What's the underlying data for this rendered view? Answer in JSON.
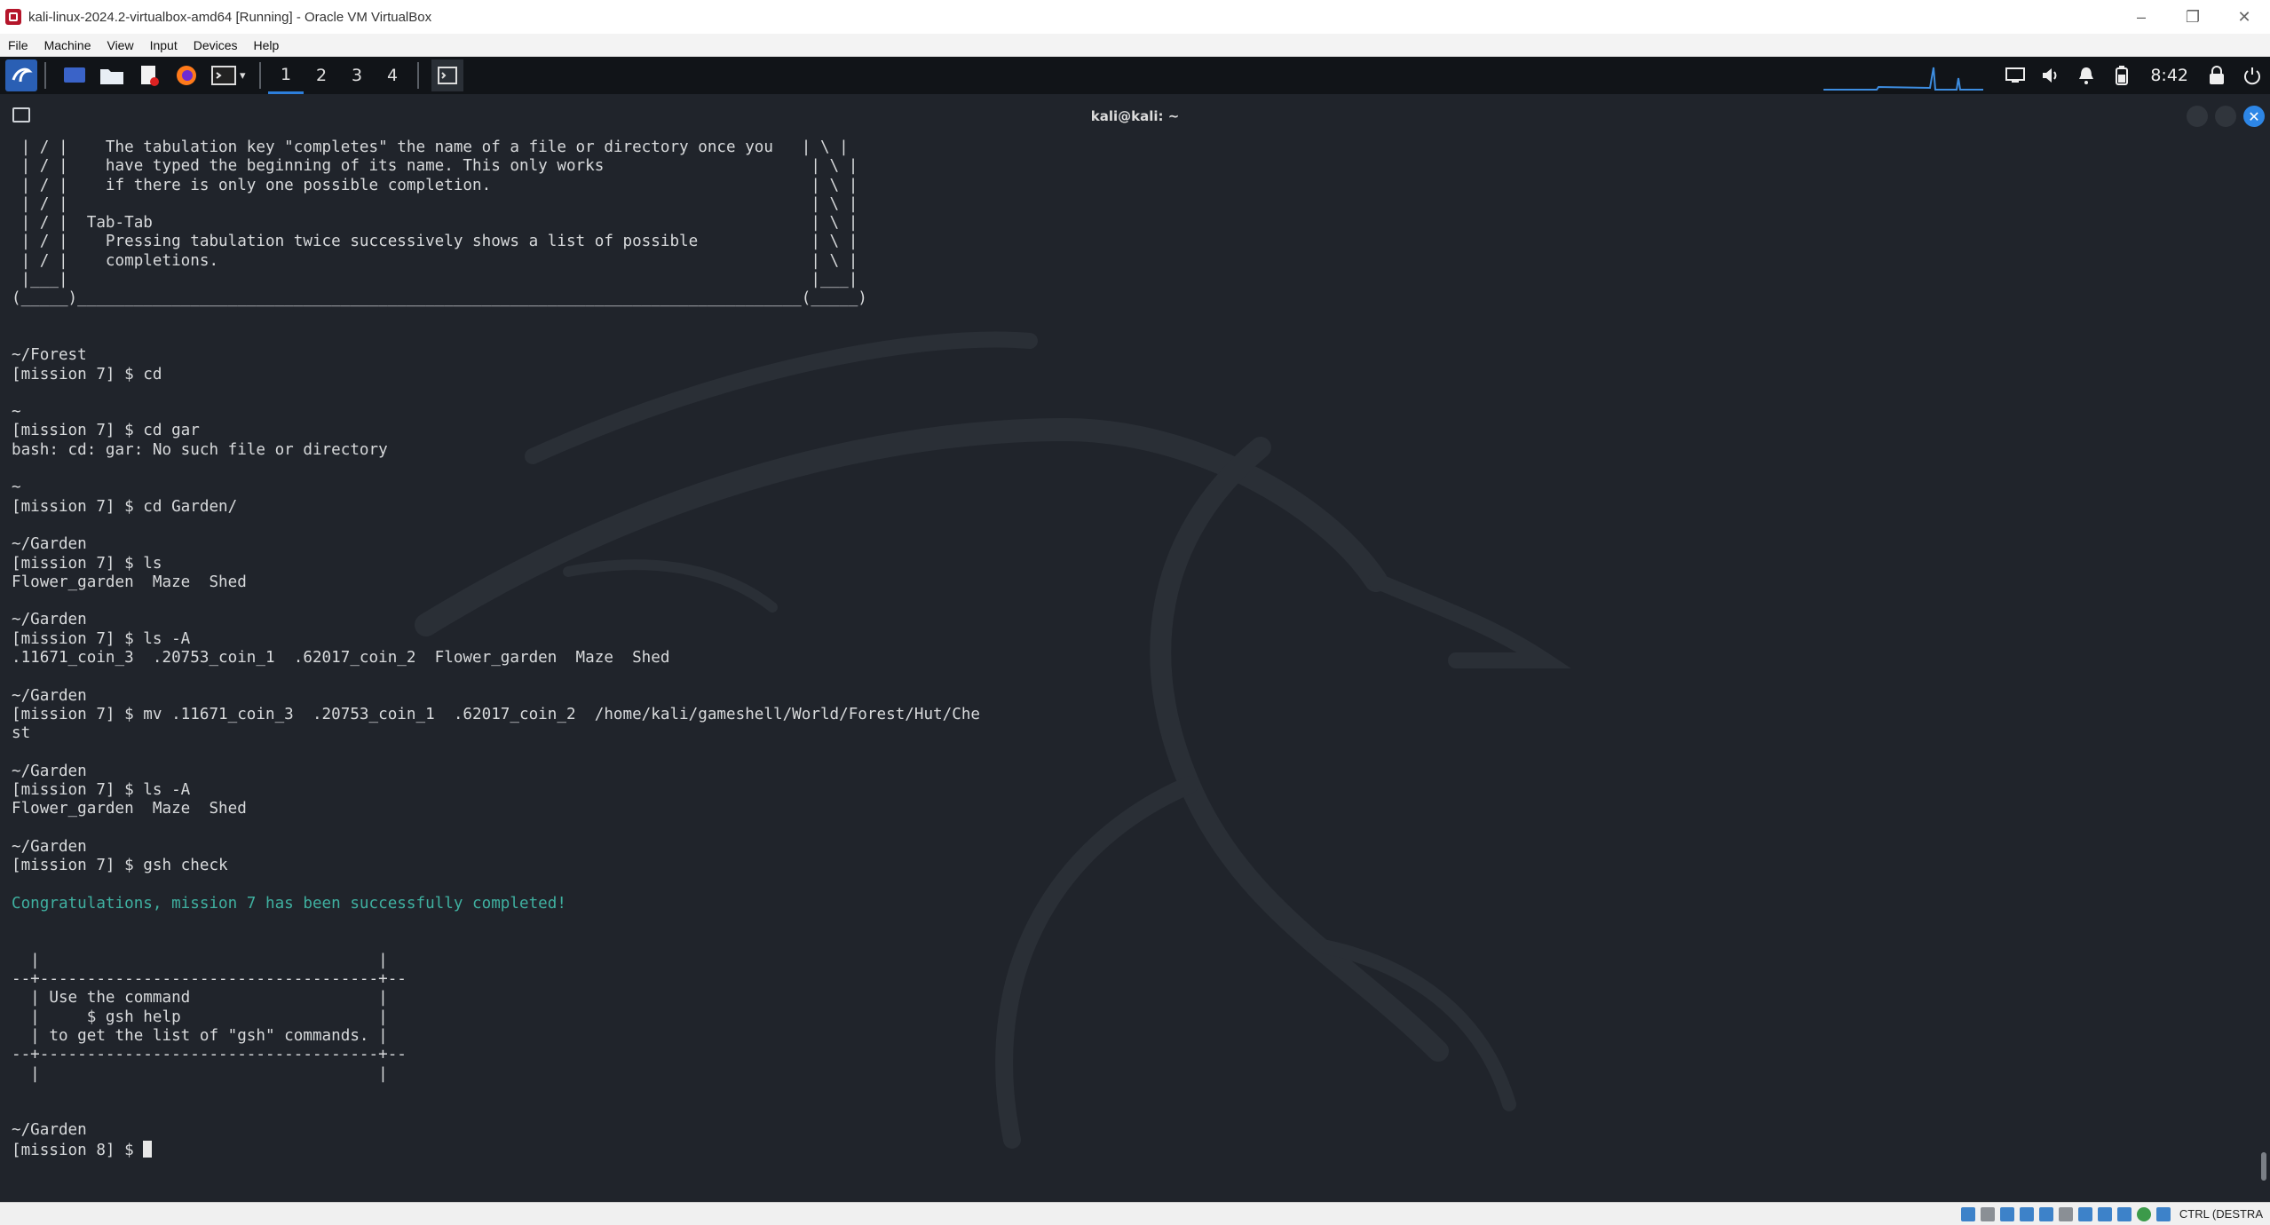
{
  "window": {
    "title": "kali-linux-2024.2-virtualbox-amd64 [Running] - Oracle VM VirtualBox",
    "menu": [
      "File",
      "Machine",
      "View",
      "Input",
      "Devices",
      "Help"
    ],
    "controls": {
      "minimize": "–",
      "restore": "❐",
      "close": "✕"
    }
  },
  "panel": {
    "workspaces": [
      "1",
      "2",
      "3",
      "4"
    ],
    "active_workspace": "1",
    "clock": "8:42",
    "launchers": [
      "kali-menu-icon",
      "desktop-icon",
      "file-manager-icon",
      "text-editor-icon",
      "firefox-icon",
      "terminal-icon"
    ]
  },
  "terminal": {
    "title": "kali@kali: ~",
    "lines": [
      " | / |    The tabulation key \"completes\" the name of a file or directory once you   | \\ |",
      " | / |    have typed the beginning of its name. This only works                      | \\ |",
      " | / |    if there is only one possible completion.                                  | \\ |",
      " | / |                                                                               | \\ |",
      " | / |  Tab-Tab                                                                      | \\ |",
      " | / |    Pressing tabulation twice successively shows a list of possible            | \\ |",
      " | / |    completions.                                                               | \\ |",
      " |___|                                                                               |___|",
      "(_____)_____________________________________________________________________________(_____)",
      "",
      "",
      "~/Forest",
      "[mission 7] $ cd",
      "",
      "~",
      "[mission 7] $ cd gar",
      "bash: cd: gar: No such file or directory",
      "",
      "~",
      "[mission 7] $ cd Garden/",
      "",
      "~/Garden",
      "[mission 7] $ ls",
      "Flower_garden  Maze  Shed",
      "",
      "~/Garden",
      "[mission 7] $ ls -A",
      ".11671_coin_3  .20753_coin_1  .62017_coin_2  Flower_garden  Maze  Shed",
      "",
      "~/Garden",
      "[mission 7] $ mv .11671_coin_3  .20753_coin_1  .62017_coin_2  /home/kali/gameshell/World/Forest/Hut/Che",
      "st",
      "",
      "~/Garden",
      "[mission 7] $ ls -A",
      "Flower_garden  Maze  Shed",
      "",
      "~/Garden",
      "[mission 7] $ gsh check",
      "",
      "Congratulations, mission 7 has been successfully completed!",
      "",
      "",
      "  |                                    |",
      "--+------------------------------------+--",
      "  | Use the command                    |",
      "  |     $ gsh help                     |",
      "  | to get the list of \"gsh\" commands. |",
      "--+------------------------------------+--",
      "  |                                    |",
      "",
      "",
      "~/Garden"
    ],
    "prompt": "[mission 8] $ "
  },
  "statusbar": {
    "host_key": "CTRL (DESTRA"
  },
  "colors": {
    "desktop_bg": "#20242b",
    "success_text": "#3fb0a0",
    "panel_bg": "#111418",
    "accent": "#2d7fdc"
  }
}
